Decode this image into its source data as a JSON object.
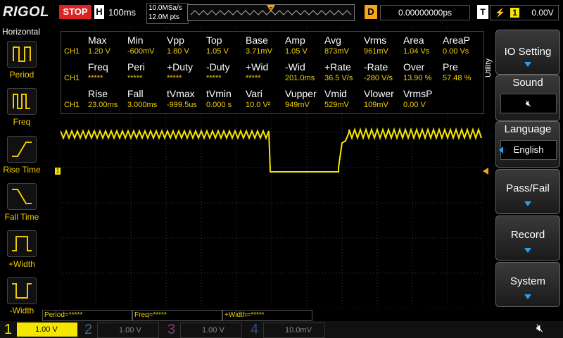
{
  "brand": "RIGOL",
  "run_state": "STOP",
  "timebase": {
    "label": "H",
    "value": "100ms"
  },
  "sample_rate": "10.0MSa/s",
  "points": "12.0M pts",
  "delay": {
    "label": "D",
    "value": "0.00000000ps"
  },
  "trigger": {
    "label": "T",
    "source": "1",
    "level": "0.00V"
  },
  "left_menu": {
    "title": "Horizontal",
    "items": [
      {
        "label": "Period"
      },
      {
        "label": "Freq"
      },
      {
        "label": "Rise Time"
      },
      {
        "label": "Fall Time"
      },
      {
        "label": "+Width"
      },
      {
        "label": "-Width"
      }
    ]
  },
  "measurements": {
    "rows": [
      {
        "headers": [
          "Max",
          "Min",
          "Vpp",
          "Top",
          "Base",
          "Amp",
          "Avg",
          "Vrms",
          "Area",
          "AreaP"
        ],
        "channel": "CH1",
        "values": [
          "1.20 V",
          "-600mV",
          "1.80 V",
          "1.05 V",
          "3.71mV",
          "1.05 V",
          "873mV",
          "961mV",
          "1.04 Vs",
          "0.00 Vs"
        ]
      },
      {
        "headers": [
          "Freq",
          "Peri",
          "+Duty",
          "-Duty",
          "+Wid",
          "-Wid",
          "+Rate",
          "-Rate",
          "Over",
          "Pre"
        ],
        "channel": "CH1",
        "values": [
          "*****",
          "*****",
          "*****",
          "*****",
          "*****",
          "201.0ms",
          "36.5 V/s",
          "-280 V/s",
          "13.90 %",
          "57.48 %"
        ]
      },
      {
        "headers": [
          "Rise",
          "Fall",
          "tVmax",
          "tVmin",
          "Vari",
          "Vupper",
          "Vmid",
          "Vlower",
          "VrmsP",
          ""
        ],
        "channel": "CH1",
        "values": [
          "23.00ms",
          "3.000ms",
          "-999.5us",
          "0.000 s",
          "10.0 V²",
          "949mV",
          "529mV",
          "109mV",
          "0.00 V",
          ""
        ]
      }
    ]
  },
  "right_menu": {
    "tab": "Utility",
    "io_setting": "IO Setting",
    "sound": "Sound",
    "language": "Language",
    "language_value": "English",
    "pass_fail": "Pass/Fail",
    "record": "Record",
    "system": "System"
  },
  "status_fields": [
    "Period=*****",
    "Freq=*****",
    "+Width=*****"
  ],
  "channels": [
    {
      "num": "1",
      "scale": "1.00 V",
      "color": "#f5e600"
    },
    {
      "num": "2",
      "scale": "1.00 V",
      "color": "#00c8ff"
    },
    {
      "num": "3",
      "scale": "1.00 V",
      "color": "#e040e0"
    },
    {
      "num": "4",
      "scale": "10.0mV",
      "color": "#2060ff"
    }
  ],
  "colors": {
    "ch1": "#f5e600",
    "trigger_marker": "#f7a41d",
    "accent": "#2aa0f0"
  }
}
